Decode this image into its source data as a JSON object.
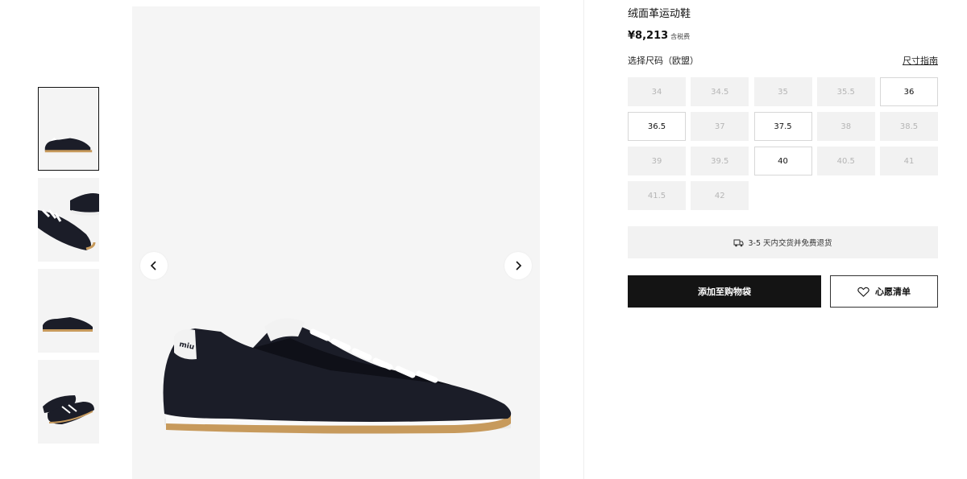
{
  "product": {
    "name": "绒面革运动鞋",
    "price": "¥8,213",
    "tax_note": "含税费"
  },
  "size_selector": {
    "label": "选择尺码（欧盟）",
    "guide_link": "尺寸指南",
    "sizes": [
      {
        "label": "34",
        "available": false
      },
      {
        "label": "34.5",
        "available": false
      },
      {
        "label": "35",
        "available": false
      },
      {
        "label": "35.5",
        "available": false
      },
      {
        "label": "36",
        "available": true
      },
      {
        "label": "36.5",
        "available": true
      },
      {
        "label": "37",
        "available": false
      },
      {
        "label": "37.5",
        "available": true
      },
      {
        "label": "38",
        "available": false
      },
      {
        "label": "38.5",
        "available": false
      },
      {
        "label": "39",
        "available": false
      },
      {
        "label": "39.5",
        "available": false
      },
      {
        "label": "40",
        "available": true
      },
      {
        "label": "40.5",
        "available": false
      },
      {
        "label": "41",
        "available": false
      },
      {
        "label": "41.5",
        "available": false
      },
      {
        "label": "42",
        "available": false
      }
    ]
  },
  "delivery": {
    "icon": "delivery-truck-icon",
    "text": "3-5 天内交货并免费退货"
  },
  "actions": {
    "add_to_bag": "添加至购物袋",
    "wishlist": "心愿清单",
    "wishlist_icon": "heart-icon"
  },
  "gallery": {
    "thumbnail_count": 4,
    "active_index": 0,
    "prev_icon": "chevron-left-icon",
    "next_icon": "chevron-right-icon"
  },
  "colors": {
    "button_dark": "#141414",
    "unavailable_bg": "#f2f2f2",
    "shoe_upper": "#1b1d28",
    "sole": "#c79a5c"
  }
}
